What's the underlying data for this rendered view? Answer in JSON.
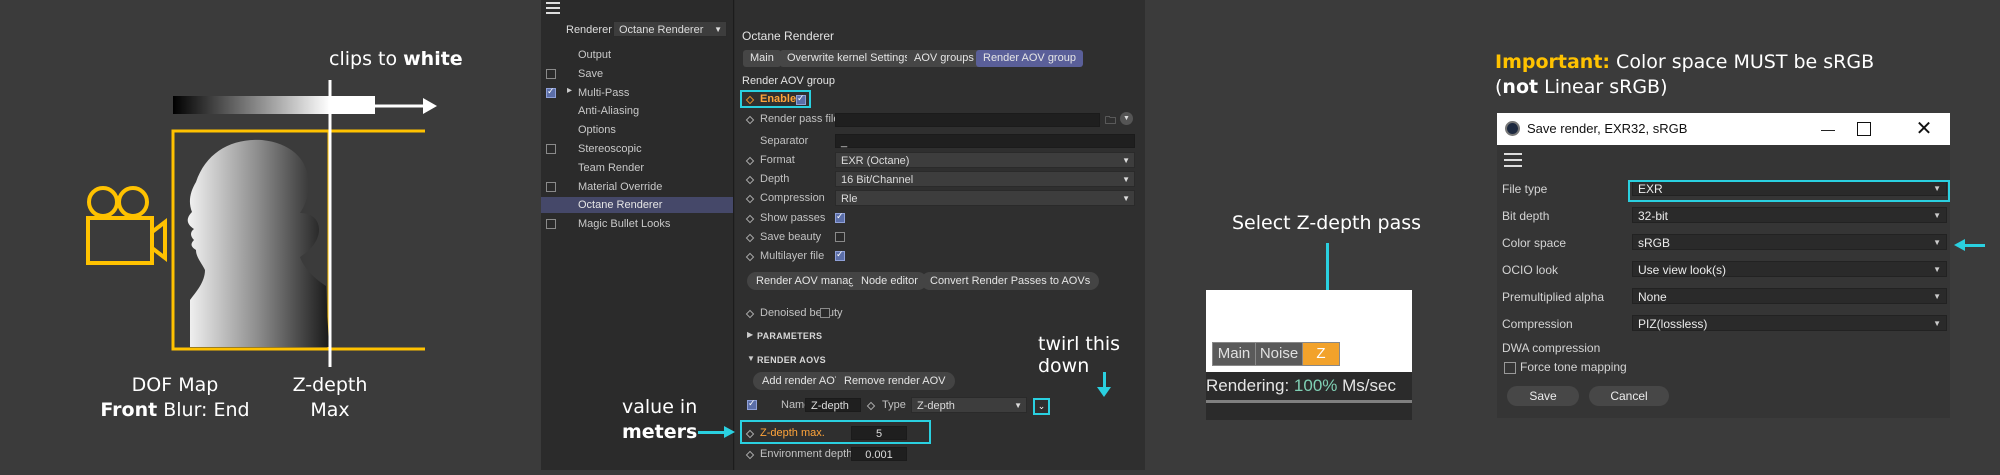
{
  "panel1": {
    "clips_label": "clips to",
    "clips_bold": "white",
    "dof_line1": "DOF Map",
    "dof_bold": "Front",
    "dof_rest": " Blur: End",
    "zdepth_line1": "Z-depth",
    "zdepth_line2": "Max",
    "colors": {
      "accent": "#ffc200",
      "line": "#ffffff"
    }
  },
  "c4d": {
    "renderer_label": "Renderer",
    "renderer_value": "Octane Renderer",
    "menu": [
      {
        "label": "Output",
        "checkbox": "none"
      },
      {
        "label": "Save",
        "checkbox": "off"
      },
      {
        "label": "Multi-Pass",
        "checkbox": "on"
      },
      {
        "label": "Anti-Aliasing",
        "checkbox": "none"
      },
      {
        "label": "Options",
        "checkbox": "none"
      },
      {
        "label": "Stereoscopic",
        "checkbox": "off"
      },
      {
        "label": "Team Render",
        "checkbox": "none"
      },
      {
        "label": "Material Override",
        "checkbox": "off"
      },
      {
        "label": "Octane Renderer",
        "checkbox": "none",
        "selected": true
      },
      {
        "label": "Magic Bullet Looks",
        "checkbox": "off"
      }
    ],
    "panel_title": "Octane Renderer",
    "tabs": [
      "Main",
      "Overwrite kernel Settings",
      "AOV groups",
      "Render AOV group"
    ],
    "group_title": "Render AOV group",
    "enable_label": "Enable",
    "render_pass_file_label": "Render pass file",
    "separator_label": "Separator",
    "separator_value": "_",
    "format_label": "Format",
    "format_value": "EXR (Octane)",
    "depth_label": "Depth",
    "depth_value": "16 Bit/Channel",
    "compression_label": "Compression",
    "compression_value": "Rle",
    "show_passes_label": "Show passes",
    "save_beauty_label": "Save beauty",
    "multilayer_label": "Multilayer file",
    "btn_aov_manager": "Render AOV manager",
    "btn_node_editor": "Node editor",
    "btn_convert": "Convert Render Passes to AOVs",
    "denoised_label": "Denoised beauty",
    "params_label": "PARAMETERS",
    "render_aovs_label": "RENDER AOVS",
    "btn_add_aov": "Add render AOV",
    "btn_remove_aov": "Remove render AOV",
    "name_label": "Name",
    "name_value": "Z-depth",
    "type_label": "Type",
    "type_value": "Z-depth",
    "zdepth_max_label": "Z-depth max.",
    "zdepth_max_value": "5",
    "env_depth_label": "Environment depth",
    "env_depth_value": "0.001",
    "annot_twirl_1": "twirl this",
    "annot_twirl_2": "down",
    "annot_value_1": "value in",
    "annot_value_2": "meters"
  },
  "panel3": {
    "caption": "Select Z-depth pass",
    "tabs": [
      "Main",
      "Noise",
      "Z"
    ],
    "rendering_label": "Rendering:",
    "rendering_pct": "100%",
    "rendering_unit": "Ms/sec",
    "progress": 1.0
  },
  "save_dialog": {
    "important_label": "Important:",
    "important_rest": " Color space MUST be sRGB",
    "note_open": "(",
    "note_bold": "not",
    "note_rest": " Linear sRGB)",
    "title": "Save render, EXR32, sRGB",
    "rows": [
      {
        "label": "File type",
        "value": "EXR"
      },
      {
        "label": "Bit depth",
        "value": "32-bit"
      },
      {
        "label": "Color space",
        "value": "sRGB"
      },
      {
        "label": "OCIO look",
        "value": "Use view look(s)"
      },
      {
        "label": "Premultiplied alpha",
        "value": "None"
      },
      {
        "label": "Compression",
        "value": "PIZ(lossless)"
      }
    ],
    "dwa_label": "DWA compression",
    "force_tone_label": "Force tone mapping",
    "save_btn": "Save",
    "cancel_btn": "Cancel"
  }
}
